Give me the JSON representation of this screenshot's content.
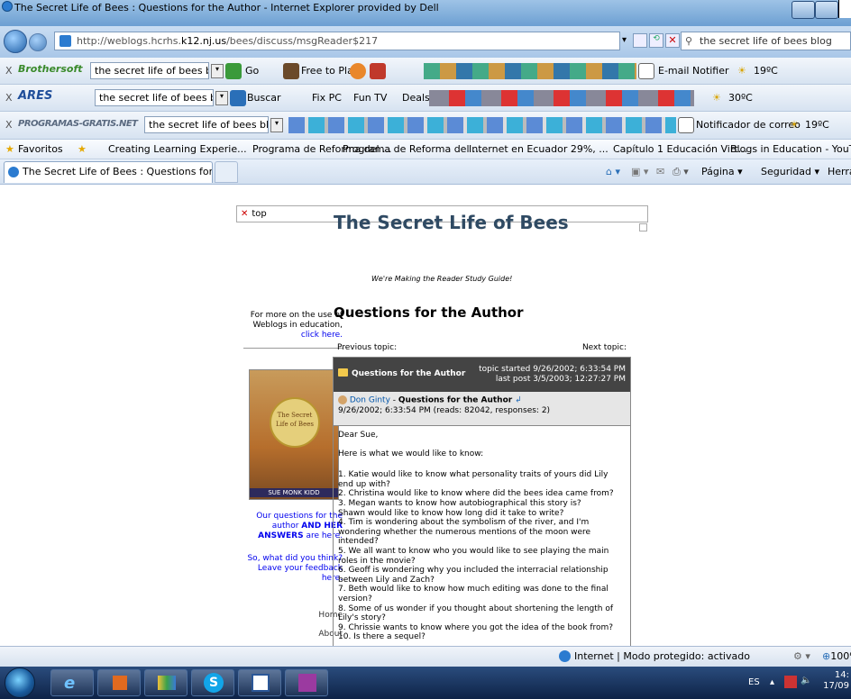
{
  "window": {
    "title": "The Secret Life of Bees : Questions for the Author - Internet Explorer provided by Dell"
  },
  "address_bar": {
    "url_prefix": "http://weblogs.hcrhs.",
    "url_domain": "k12.nj.us",
    "url_suffix": "/bees/discuss/msgReader$217",
    "search_value": "the secret life of bees blog"
  },
  "toolbars": {
    "brothersoft": {
      "logo": "Brothersoft",
      "search_value": "the secret life of bees blog",
      "go_label": "Go",
      "free_to_play_label": "Free to Play",
      "email_notifier_label": "E-mail Notifier",
      "temperature": "19ºC"
    },
    "ares": {
      "logo": "ARES",
      "search_value": "the secret life of bees blog",
      "buscar_label": "Buscar",
      "fix_pc_label": "Fix PC",
      "fun_tv_label": "Fun TV",
      "deals_label": "Deals",
      "temperature": "30ºC"
    },
    "programas": {
      "logo": "PROGRAMAS-GRATIS.NET",
      "search_value": "the secret life of bees blog",
      "notificador_label": "Notificador de correo",
      "temperature": "19ºC"
    }
  },
  "favorites_bar": {
    "favoritos_label": "Favoritos",
    "items": [
      "Creating Learning Experie...",
      "Programa de Reforma del ...",
      "Programa de Reforma del ...",
      "Internet en Ecuador 29%, ...",
      "Capítulo 1 Educación Virt...",
      "Blogs in Education - YouT..."
    ]
  },
  "tabs": {
    "active_tab": "The Secret Life of Bees : Questions for the Author"
  },
  "command_bar": {
    "pagina": "Página ▾",
    "seguridad": "Seguridad ▾",
    "herramientas": "Herramientas ▾"
  },
  "page": {
    "broken_image_alt": "top",
    "site_title": "The Secret Life of Bees",
    "tagline": "We're Making the Reader Study Guide!",
    "sidebar": {
      "weblogs_text": "For more on the use of Weblogs in education,",
      "weblogs_link": "click here.",
      "book_cover_title": "The Secret Life of Bees",
      "book_cover_author": "SUE MONK KIDD",
      "questions_text_1": "Our questions for the author ",
      "questions_text_bold": "AND HER ANSWERS",
      "questions_text_2": " are here.",
      "feedback_text": "So, what did you think? Leave your feedback here.",
      "nav_home": "Home",
      "nav_about": "About"
    },
    "heading": "Questions for the Author",
    "previous_topic": "Previous topic:",
    "next_topic": "Next topic:",
    "topic": {
      "name": "Questions for the Author",
      "started": "topic started 9/26/2002; 6:33:54 PM",
      "last_post": "last post 3/5/2003; 12:27:27 PM"
    },
    "message": {
      "author": "Don Ginty",
      "separator": " - ",
      "subject": "Questions for the Author",
      "meta": "9/26/2002; 6:33:54 PM (reads: 82042, responses: 2)",
      "greeting": "Dear Sue,",
      "intro": "Here is what we would like to know:",
      "lines": [
        "1. Katie would like to know what personality traits of yours did Lily end up with?",
        "2. Christina would like to know where did the bees idea came from?",
        "3. Megan wants to know how autobiographical this story is?",
        "Shawn would like to know how long did it take to write?",
        "4. Tim is wondering about the symbolism of the river, and I'm wondering whether the numerous mentions of the moon were intended?",
        "5. We all want to know who you would like to see playing the main roles in the movie?",
        "6. Geoff is wondering why you included the interracial relationship between Lily and Zach?",
        "7. Beth would like to know how much editing was done to the final version?",
        "8. Some of us wonder if you thought about shortening the length of Lily's story?",
        "9. Chrissie wants to know where you got the idea of the book from?",
        "10. Is there a sequel?"
      ]
    }
  },
  "status_bar": {
    "zone": "Internet | Modo protegido: activado",
    "zoom": "100%"
  },
  "taskbar": {
    "language": "ES",
    "time": "14:",
    "date": "17/09"
  }
}
